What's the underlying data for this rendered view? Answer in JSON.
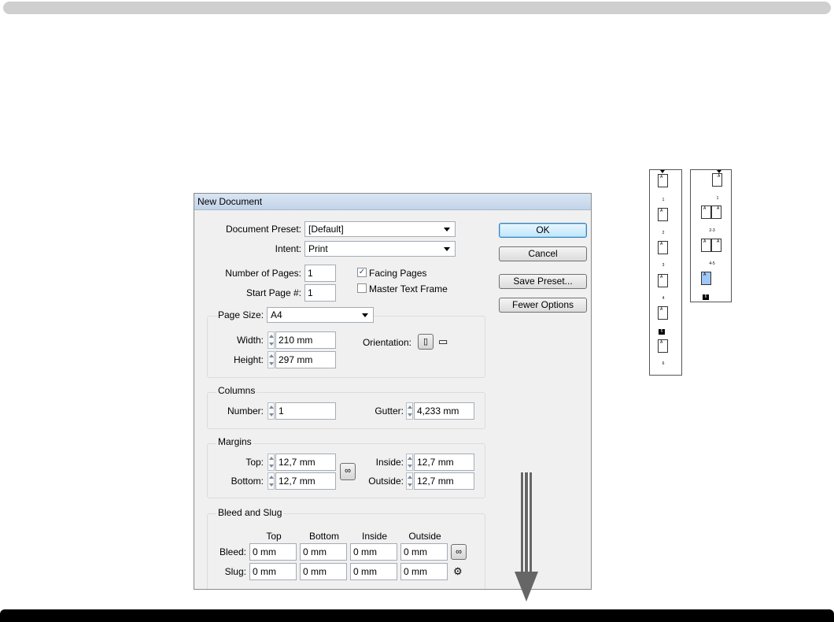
{
  "dialog": {
    "title": "New Document",
    "preset_label": "Document Preset:",
    "preset_value": "[Default]",
    "intent_label": "Intent:",
    "intent_value": "Print",
    "num_pages_label": "Number of Pages:",
    "num_pages_value": "1",
    "start_page_label": "Start Page #:",
    "start_page_value": "1",
    "facing_pages_label": "Facing Pages",
    "facing_pages_checked": true,
    "master_text_frame_label": "Master Text Frame",
    "master_text_frame_checked": false,
    "page_size_label": "Page Size:",
    "page_size_value": "A4",
    "width_label": "Width:",
    "width_value": "210 mm",
    "height_label": "Height:",
    "height_value": "297 mm",
    "orientation_label": "Orientation:",
    "columns": {
      "title": "Columns",
      "number_label": "Number:",
      "number_value": "1",
      "gutter_label": "Gutter:",
      "gutter_value": "4,233 mm"
    },
    "margins": {
      "title": "Margins",
      "top_label": "Top:",
      "top_value": "12,7 mm",
      "bottom_label": "Bottom:",
      "bottom_value": "12,7 mm",
      "inside_label": "Inside:",
      "inside_value": "12,7 mm",
      "outside_label": "Outside:",
      "outside_value": "12,7 mm"
    },
    "bleed_slug": {
      "title": "Bleed and Slug",
      "headers": [
        "Top",
        "Bottom",
        "Inside",
        "Outside"
      ],
      "bleed_label": "Bleed:",
      "bleed_values": [
        "0 mm",
        "0 mm",
        "0 mm",
        "0 mm"
      ],
      "slug_label": "Slug:",
      "slug_values": [
        "0 mm",
        "0 mm",
        "0 mm",
        "0 mm"
      ]
    },
    "buttons": {
      "ok": "OK",
      "cancel": "Cancel",
      "save_preset": "Save Preset...",
      "fewer_options": "Fewer Options"
    }
  },
  "pages_panel_single": {
    "master_letter": "A",
    "page_numbers": [
      "1",
      "2",
      "3",
      "4",
      "5",
      "6"
    ],
    "selected_page": "5"
  },
  "pages_panel_facing": {
    "master_letter": "A",
    "spread_labels": [
      "1",
      "2-3",
      "4-5",
      "6"
    ],
    "selected_page": "6"
  },
  "colors": {
    "titlebar": "#c9d8ec",
    "dialog_bg": "#f0f0f0",
    "selected_page": "#9ec8f5",
    "arrow": "#666666"
  }
}
